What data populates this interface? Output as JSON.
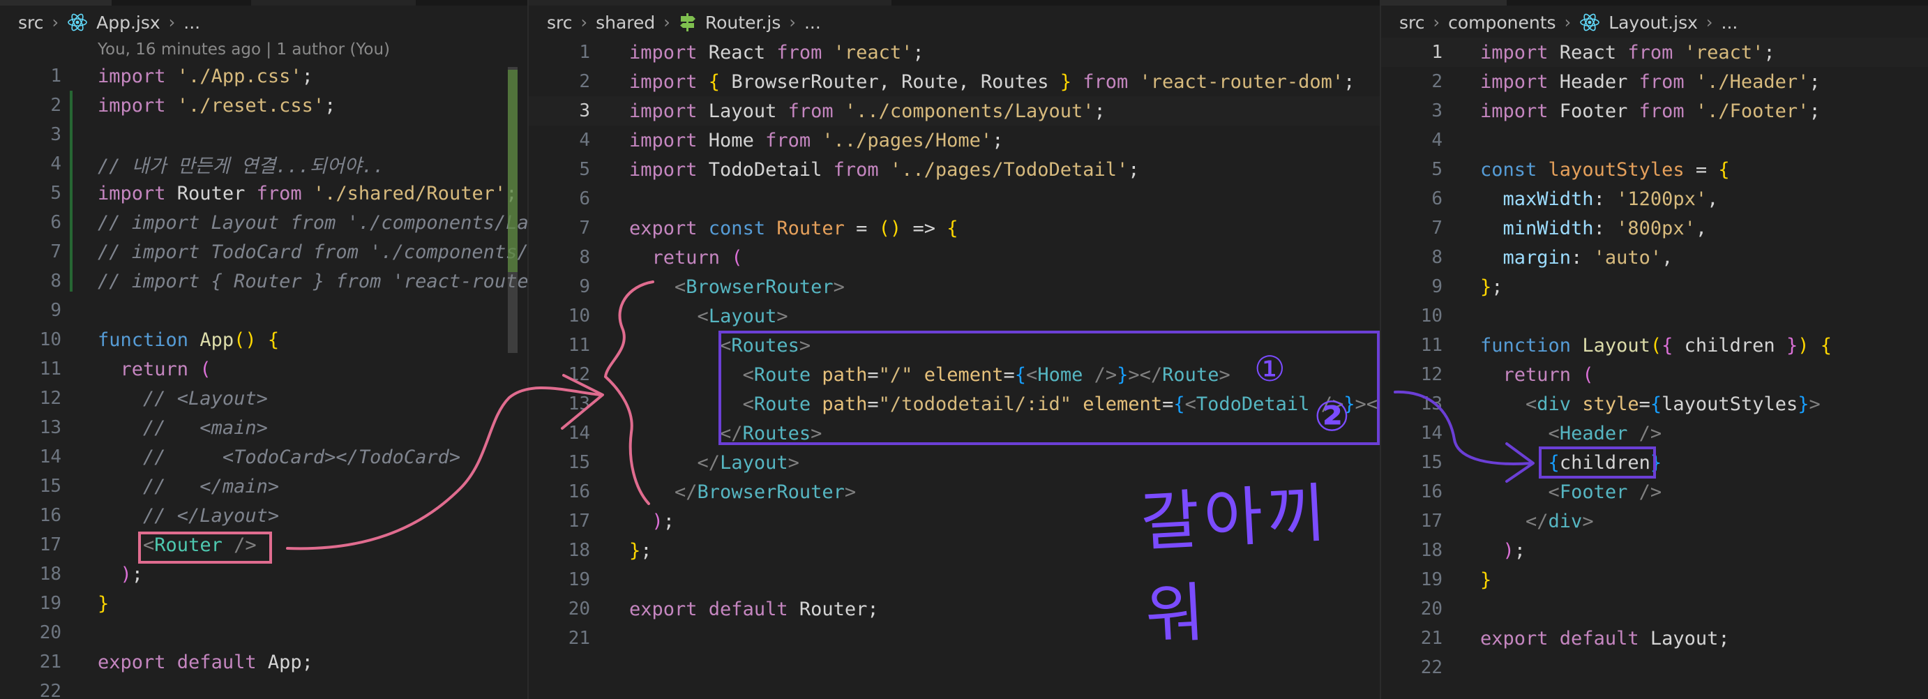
{
  "panes": [
    {
      "id": "app",
      "breadcrumb": [
        "src",
        "App.jsx",
        "..."
      ],
      "blame": "You, 16 minutes ago | 1 author (You)",
      "lines": [
        [
          [
            "k",
            "import "
          ],
          [
            "s",
            "'./App.css'"
          ],
          [
            "w",
            ";"
          ]
        ],
        [
          [
            "k",
            "import "
          ],
          [
            "s",
            "'./reset.css'"
          ],
          [
            "w",
            ";"
          ]
        ],
        [],
        [
          [
            "cm",
            "// 내가 만든게 연결...되어야.."
          ]
        ],
        [
          [
            "k",
            "import "
          ],
          [
            "w",
            "Router "
          ],
          [
            "k",
            "from "
          ],
          [
            "s",
            "'./shared/Router'"
          ],
          [
            "w",
            ";"
          ]
        ],
        [
          [
            "cm",
            "// import Layout from './components/La"
          ]
        ],
        [
          [
            "cm",
            "// import TodoCard from './components/"
          ]
        ],
        [
          [
            "cm",
            "// import { Router } from 'react-route"
          ]
        ],
        [],
        [
          [
            "kb",
            "function "
          ],
          [
            "f",
            "App"
          ],
          [
            "y",
            "()"
          ],
          [
            "w",
            " "
          ],
          [
            "y",
            "{"
          ]
        ],
        [
          [
            "w",
            "  "
          ],
          [
            "k",
            "return "
          ],
          [
            "pk",
            "("
          ]
        ],
        [
          [
            "w",
            "    "
          ],
          [
            "cm",
            "// <Layout>"
          ]
        ],
        [
          [
            "w",
            "    "
          ],
          [
            "cm",
            "//   <main>"
          ]
        ],
        [
          [
            "w",
            "    "
          ],
          [
            "cm",
            "//     <TodoCard></TodoCard>"
          ]
        ],
        [
          [
            "w",
            "    "
          ],
          [
            "cm",
            "//   </main>"
          ]
        ],
        [
          [
            "w",
            "    "
          ],
          [
            "cm",
            "// </Layout>"
          ]
        ],
        [
          [
            "w",
            "    "
          ],
          [
            "p",
            "<"
          ],
          [
            "t",
            "Router"
          ],
          [
            "w",
            " "
          ],
          [
            "p",
            "/>"
          ]
        ],
        [
          [
            "w",
            "  "
          ],
          [
            "pk",
            ")"
          ],
          [
            "w",
            ";"
          ]
        ],
        [
          [
            "y",
            "}"
          ]
        ],
        [],
        [
          [
            "k",
            "export "
          ],
          [
            "k",
            "default "
          ],
          [
            "w",
            "App;"
          ]
        ],
        []
      ]
    },
    {
      "id": "router",
      "breadcrumb": [
        "src",
        "shared",
        "Router.js",
        "..."
      ],
      "lines": [
        [
          [
            "k",
            "import "
          ],
          [
            "w",
            "React "
          ],
          [
            "k",
            "from "
          ],
          [
            "s",
            "'react'"
          ],
          [
            "w",
            ";"
          ]
        ],
        [
          [
            "k",
            "import "
          ],
          [
            "y",
            "{ "
          ],
          [
            "w",
            "BrowserRouter, Route, Routes "
          ],
          [
            "y",
            "}"
          ],
          [
            "w",
            " "
          ],
          [
            "k",
            "from "
          ],
          [
            "s",
            "'react-router-dom'"
          ],
          [
            "w",
            ";"
          ]
        ],
        [
          [
            "k",
            "import "
          ],
          [
            "w",
            "Layout "
          ],
          [
            "k",
            "from "
          ],
          [
            "s",
            "'../components/Layout'"
          ],
          [
            "w",
            ";"
          ]
        ],
        [
          [
            "k",
            "import "
          ],
          [
            "w",
            "Home "
          ],
          [
            "k",
            "from "
          ],
          [
            "s",
            "'../pages/Home'"
          ],
          [
            "w",
            ";"
          ]
        ],
        [
          [
            "k",
            "import "
          ],
          [
            "w",
            "TodoDetail "
          ],
          [
            "k",
            "from "
          ],
          [
            "s",
            "'../pages/TodoDetail'"
          ],
          [
            "w",
            ";"
          ]
        ],
        [],
        [
          [
            "k",
            "export "
          ],
          [
            "kb",
            "const "
          ],
          [
            "a",
            "Router"
          ],
          [
            "w",
            " = "
          ],
          [
            "y",
            "()"
          ],
          [
            "w",
            " => "
          ],
          [
            "y",
            "{"
          ]
        ],
        [
          [
            "w",
            "  "
          ],
          [
            "k",
            "return "
          ],
          [
            "pk",
            "("
          ]
        ],
        [
          [
            "w",
            "    "
          ],
          [
            "p",
            "<"
          ],
          [
            "tg",
            "BrowserRouter"
          ],
          [
            "p",
            ">"
          ]
        ],
        [
          [
            "w",
            "      "
          ],
          [
            "p",
            "<"
          ],
          [
            "tg",
            "Layout"
          ],
          [
            "p",
            ">"
          ]
        ],
        [
          [
            "w",
            "        "
          ],
          [
            "p",
            "<"
          ],
          [
            "tg",
            "Routes"
          ],
          [
            "p",
            ">"
          ]
        ],
        [
          [
            "w",
            "          "
          ],
          [
            "p",
            "<"
          ],
          [
            "tg",
            "Route"
          ],
          [
            "w",
            " "
          ],
          [
            "fo",
            "path"
          ],
          [
            "w",
            "="
          ],
          [
            "s",
            "\"/\""
          ],
          [
            "w",
            " "
          ],
          [
            "fo",
            "element"
          ],
          [
            "w",
            "="
          ],
          [
            "bl",
            "{"
          ],
          [
            "p",
            "<"
          ],
          [
            "tg",
            "Home"
          ],
          [
            "w",
            " "
          ],
          [
            "p",
            "/>"
          ],
          [
            "bl",
            "}"
          ],
          [
            "p",
            "></"
          ],
          [
            "tg",
            "Route"
          ],
          [
            "p",
            ">"
          ]
        ],
        [
          [
            "w",
            "          "
          ],
          [
            "p",
            "<"
          ],
          [
            "tg",
            "Route"
          ],
          [
            "w",
            " "
          ],
          [
            "fo",
            "path"
          ],
          [
            "w",
            "="
          ],
          [
            "s",
            "\"/tododetail/:id\""
          ],
          [
            "w",
            " "
          ],
          [
            "fo",
            "element"
          ],
          [
            "w",
            "="
          ],
          [
            "bl",
            "{"
          ],
          [
            "p",
            "<"
          ],
          [
            "tg",
            "TodoDetail"
          ],
          [
            "w",
            " "
          ],
          [
            "p",
            "/>"
          ],
          [
            "bl",
            "}"
          ],
          [
            "p",
            "></"
          ]
        ],
        [
          [
            "w",
            "        "
          ],
          [
            "p",
            "</"
          ],
          [
            "tg",
            "Routes"
          ],
          [
            "p",
            ">"
          ]
        ],
        [
          [
            "w",
            "      "
          ],
          [
            "p",
            "</"
          ],
          [
            "tg",
            "Layout"
          ],
          [
            "p",
            ">"
          ]
        ],
        [
          [
            "w",
            "    "
          ],
          [
            "p",
            "</"
          ],
          [
            "tg",
            "BrowserRouter"
          ],
          [
            "p",
            ">"
          ]
        ],
        [
          [
            "w",
            "  "
          ],
          [
            "pk",
            ")"
          ],
          [
            "w",
            ";"
          ]
        ],
        [
          [
            "y",
            "}"
          ],
          [
            "w",
            ";"
          ]
        ],
        [],
        [
          [
            "k",
            "export "
          ],
          [
            "k",
            "default "
          ],
          [
            "w",
            "Router;"
          ]
        ],
        []
      ]
    },
    {
      "id": "layout",
      "breadcrumb": [
        "src",
        "components",
        "Layout.jsx",
        "..."
      ],
      "lines": [
        [
          [
            "k",
            "import "
          ],
          [
            "w",
            "React "
          ],
          [
            "k",
            "from "
          ],
          [
            "s",
            "'react'"
          ],
          [
            "w",
            ";"
          ]
        ],
        [
          [
            "k",
            "import "
          ],
          [
            "w",
            "Header "
          ],
          [
            "k",
            "from "
          ],
          [
            "s",
            "'./Header'"
          ],
          [
            "w",
            ";"
          ]
        ],
        [
          [
            "k",
            "import "
          ],
          [
            "w",
            "Footer "
          ],
          [
            "k",
            "from "
          ],
          [
            "s",
            "'./Footer'"
          ],
          [
            "w",
            ";"
          ]
        ],
        [],
        [
          [
            "kb",
            "const "
          ],
          [
            "a",
            "layoutStyles"
          ],
          [
            "w",
            " = "
          ],
          [
            "y",
            "{"
          ]
        ],
        [
          [
            "w",
            "  "
          ],
          [
            "v",
            "maxWidth"
          ],
          [
            "w",
            ": "
          ],
          [
            "s",
            "'1200px'"
          ],
          [
            "w",
            ","
          ]
        ],
        [
          [
            "w",
            "  "
          ],
          [
            "v",
            "minWidth"
          ],
          [
            "w",
            ": "
          ],
          [
            "s",
            "'800px'"
          ],
          [
            "w",
            ","
          ]
        ],
        [
          [
            "w",
            "  "
          ],
          [
            "v",
            "margin"
          ],
          [
            "w",
            ": "
          ],
          [
            "s",
            "'auto'"
          ],
          [
            "w",
            ","
          ]
        ],
        [
          [
            "y",
            "}"
          ],
          [
            "w",
            ";"
          ]
        ],
        [],
        [
          [
            "kb",
            "function "
          ],
          [
            "f",
            "Layout"
          ],
          [
            "y",
            "("
          ],
          [
            "pk",
            "{ "
          ],
          [
            "w",
            "children "
          ],
          [
            "pk",
            "}"
          ],
          [
            "y",
            ")"
          ],
          [
            "w",
            " "
          ],
          [
            "y",
            "{"
          ]
        ],
        [
          [
            "w",
            "  "
          ],
          [
            "k",
            "return "
          ],
          [
            "pk",
            "("
          ]
        ],
        [
          [
            "w",
            "    "
          ],
          [
            "p",
            "<"
          ],
          [
            "tg",
            "div"
          ],
          [
            "w",
            " "
          ],
          [
            "fo",
            "style"
          ],
          [
            "w",
            "="
          ],
          [
            "bl",
            "{"
          ],
          [
            "w",
            "layoutStyles"
          ],
          [
            "bl",
            "}"
          ],
          [
            "p",
            ">"
          ]
        ],
        [
          [
            "w",
            "      "
          ],
          [
            "p",
            "<"
          ],
          [
            "tg",
            "Header"
          ],
          [
            "w",
            " "
          ],
          [
            "p",
            "/>"
          ]
        ],
        [
          [
            "w",
            "      "
          ],
          [
            "bl",
            "{"
          ],
          [
            "w",
            "children"
          ],
          [
            "bl",
            "}"
          ]
        ],
        [
          [
            "w",
            "      "
          ],
          [
            "p",
            "<"
          ],
          [
            "tg",
            "Footer"
          ],
          [
            "w",
            " "
          ],
          [
            "p",
            "/>"
          ]
        ],
        [
          [
            "w",
            "    "
          ],
          [
            "p",
            "</"
          ],
          [
            "tg",
            "div"
          ],
          [
            "p",
            ">"
          ]
        ],
        [
          [
            "w",
            "  "
          ],
          [
            "pk",
            ")"
          ],
          [
            "w",
            ";"
          ]
        ],
        [
          [
            "y",
            "}"
          ]
        ],
        [],
        [
          [
            "k",
            "export "
          ],
          [
            "k",
            "default "
          ],
          [
            "w",
            "Layout;"
          ]
        ],
        []
      ]
    }
  ],
  "annotations": {
    "marker_1": "①",
    "marker_2": "②",
    "handwritten_note": "갈아끼워"
  },
  "colors": {
    "pink": "#e06c8f",
    "purple": "#6b3fd6",
    "annotation_text": "#7b4cff"
  }
}
